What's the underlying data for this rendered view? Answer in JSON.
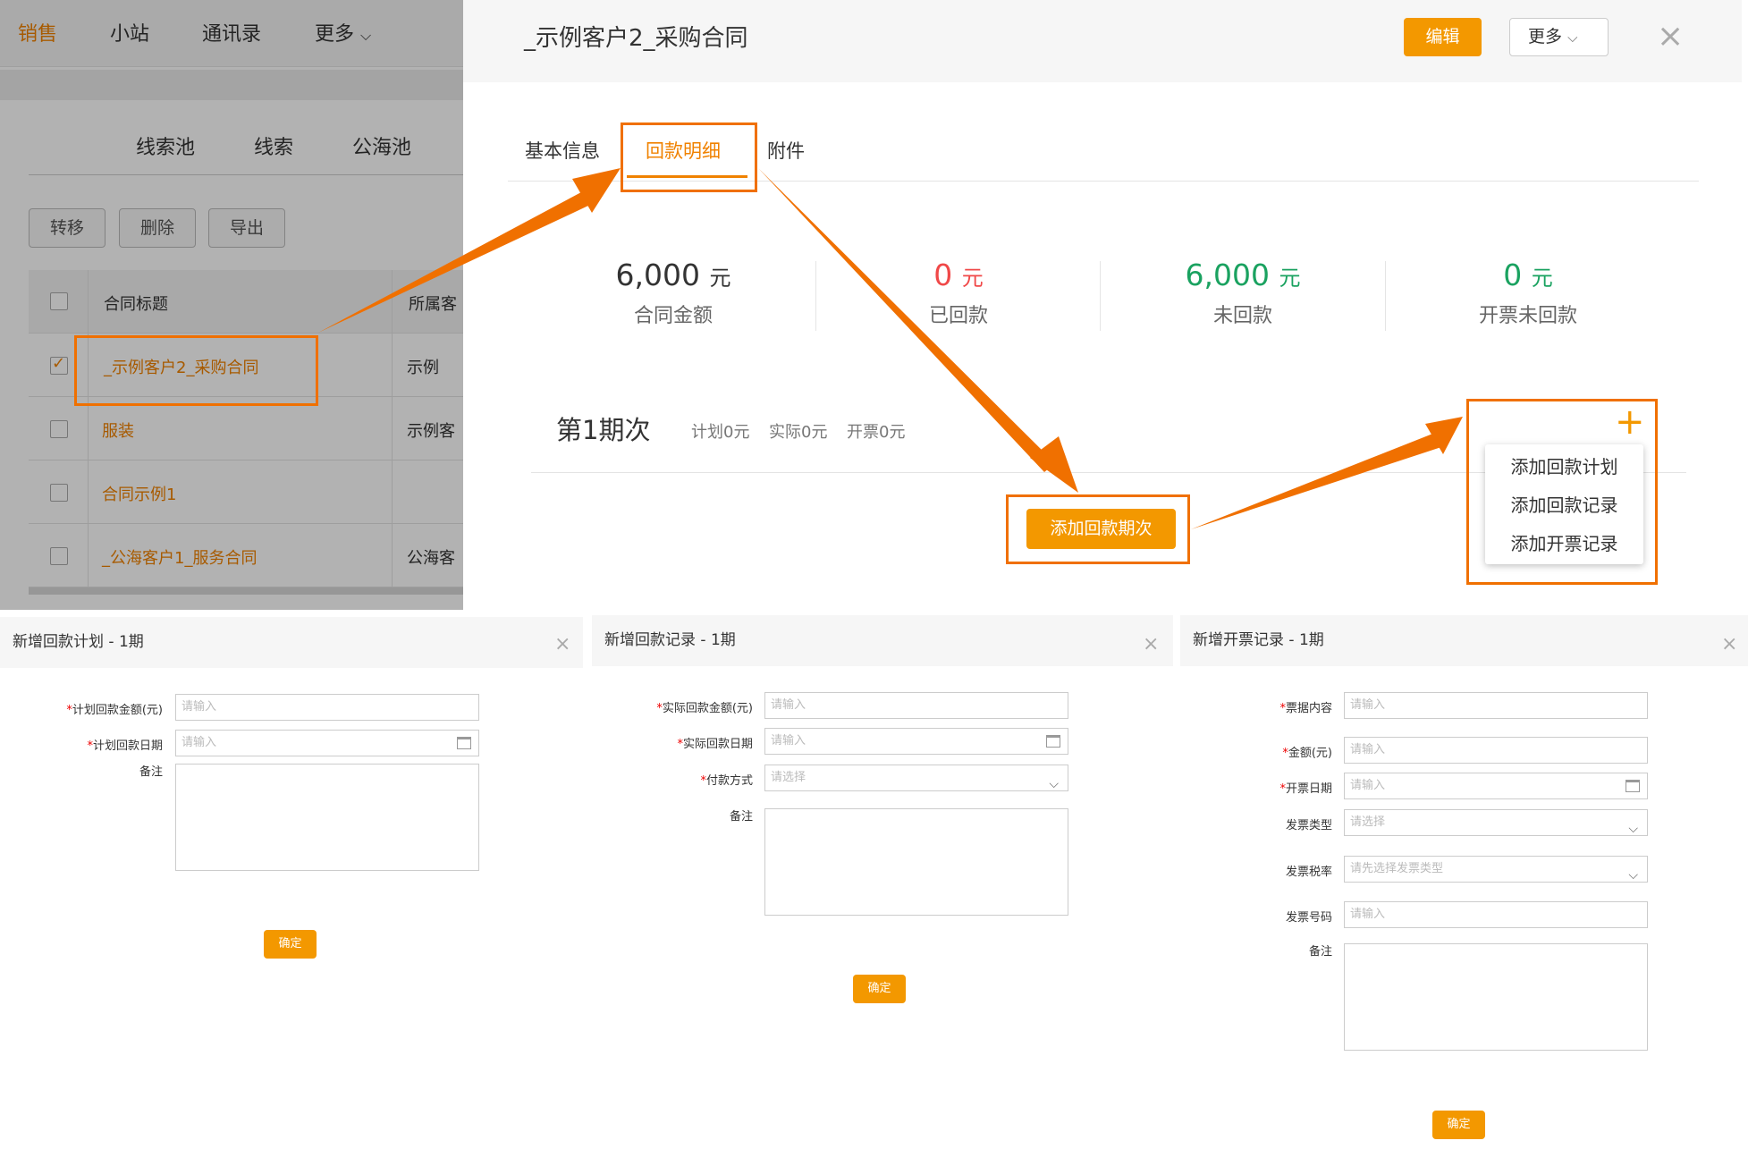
{
  "left_panel": {
    "nav": {
      "sales": "销售",
      "station": "小站",
      "contacts": "通讯录",
      "more": "更多"
    },
    "subnav": {
      "pool": "线索池",
      "leads": "线索",
      "public_pool": "公海池"
    },
    "actions": {
      "transfer": "转移",
      "delete": "删除",
      "export": "导出"
    },
    "table": {
      "headers": {
        "title": "合同标题",
        "customer": "所属客"
      },
      "rows": [
        {
          "title": "_示例客户2_采购合同",
          "customer": "示例"
        },
        {
          "title": "服装",
          "customer": "示例客"
        },
        {
          "title": "合同示例1",
          "customer": ""
        },
        {
          "title": "_公海客户1_服务合同",
          "customer": "公海客"
        }
      ]
    }
  },
  "modal": {
    "title": "_示例客户2_采购合同",
    "edit_label": "编辑",
    "more_label": "更多",
    "close_icon": "×",
    "tabs": {
      "basic": "基本信息",
      "payment": "回款明细",
      "attachment": "附件"
    },
    "stats": [
      {
        "value": "6,000",
        "unit": "元",
        "label": "合同金额",
        "color": "#333333"
      },
      {
        "value": "0",
        "unit": "元",
        "label": "已回款",
        "color": "#f04848"
      },
      {
        "value": "6,000",
        "unit": "元",
        "label": "未回款",
        "color": "#1aa260"
      },
      {
        "value": "0",
        "unit": "元",
        "label": "开票未回款",
        "color": "#1aa260"
      }
    ],
    "period": {
      "title": "第1期次",
      "plan": "计划0元",
      "actual": "实际0元",
      "invoice": "开票0元"
    },
    "add_period_label": "添加回款期次",
    "plus_icon": "+",
    "menu": {
      "item1": "添加回款计划",
      "item2": "添加回款记录",
      "item3": "添加开票记录"
    }
  },
  "forms": {
    "plan": {
      "title": "新增回款计划 - 1期",
      "amount_label": "计划回款金额(元)",
      "amount_placeholder": "请输入",
      "date_label": "计划回款日期",
      "date_placeholder": "请输入",
      "remark_label": "备注",
      "confirm": "确定"
    },
    "record": {
      "title": "新增回款记录 - 1期",
      "amount_label": "实际回款金额(元)",
      "amount_placeholder": "请输入",
      "date_label": "实际回款日期",
      "date_placeholder": "请输入",
      "method_label": "付款方式",
      "method_placeholder": "请选择",
      "remark_label": "备注",
      "confirm": "确定"
    },
    "invoice": {
      "title": "新增开票记录 - 1期",
      "content_label": "票据内容",
      "content_placeholder": "请输入",
      "amount_label": "金额(元)",
      "amount_placeholder": "请输入",
      "date_label": "开票日期",
      "date_placeholder": "请输入",
      "type_label": "发票类型",
      "type_placeholder": "请选择",
      "rate_label": "发票税率",
      "rate_placeholder": "请先选择发票类型",
      "number_label": "发票号码",
      "number_placeholder": "请输入",
      "remark_label": "备注",
      "confirm": "确定"
    }
  },
  "colors": {
    "accent": "#f39800",
    "highlight": "#f07000",
    "overlay": "rgba(0,0,0,0.30)"
  }
}
